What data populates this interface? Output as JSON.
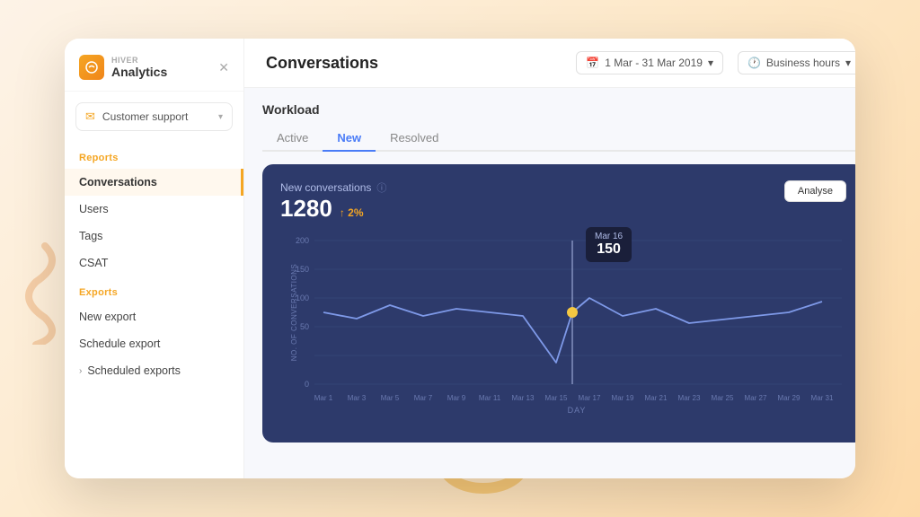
{
  "sidebar": {
    "brand": {
      "hiver": "HIVER",
      "analytics": "Analytics"
    },
    "dropdown": {
      "label": "Customer support"
    },
    "sections": [
      {
        "id": "reports",
        "label": "Reports",
        "items": [
          {
            "id": "conversations",
            "label": "Conversations",
            "active": true
          },
          {
            "id": "users",
            "label": "Users"
          },
          {
            "id": "tags",
            "label": "Tags"
          },
          {
            "id": "csat",
            "label": "CSAT"
          }
        ]
      },
      {
        "id": "exports",
        "label": "Exports",
        "items": [
          {
            "id": "new-export",
            "label": "New export"
          },
          {
            "id": "schedule-export",
            "label": "Schedule export"
          },
          {
            "id": "scheduled-exports",
            "label": "Scheduled exports",
            "expand": true
          }
        ]
      }
    ]
  },
  "header": {
    "title": "Conversations",
    "date_range": "1 Mar - 31 Mar 2019",
    "business_hours": "Business hours"
  },
  "workload": {
    "title": "Workload",
    "tabs": [
      {
        "id": "active",
        "label": "Active"
      },
      {
        "id": "new",
        "label": "New",
        "active": true
      },
      {
        "id": "resolved",
        "label": "Resolved"
      }
    ]
  },
  "chart": {
    "title": "New conversations",
    "total": "1280",
    "change": "↑ 2%",
    "analyse_btn": "Analyse",
    "tooltip": {
      "date": "Mar 16",
      "value": "150"
    },
    "y_axis_label": "NO. OF CONVERSATIONS",
    "x_axis_label": "DAY",
    "y_ticks": [
      "200",
      "150",
      "100",
      "50",
      "0"
    ],
    "x_ticks": [
      "Mar 1",
      "Mar 3",
      "Mar 5",
      "Mar 7",
      "Mar 9",
      "Mar 11",
      "Mar 13",
      "Mar 15",
      "Mar 17",
      "Mar 19",
      "Mar 21",
      "Mar 23",
      "Mar 25",
      "Mar 27",
      "Mar 29",
      "Mar 31"
    ]
  }
}
